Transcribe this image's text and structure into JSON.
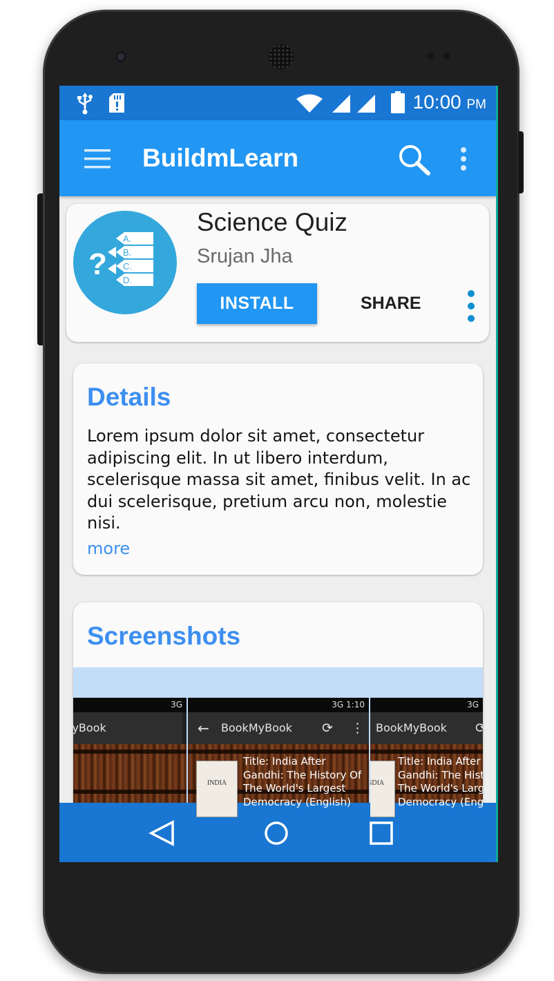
{
  "status_bar": {
    "time": "10:00",
    "ampm": "PM",
    "icons": [
      "usb-icon",
      "sd-card-icon",
      "wifi-icon",
      "signal-icon",
      "signal-icon",
      "battery-icon"
    ]
  },
  "app_bar": {
    "title": "BuildmLearn",
    "icons": [
      "menu-icon",
      "search-icon",
      "overflow-menu-icon"
    ]
  },
  "app_card": {
    "name": "Science Quiz",
    "author": "Srujan Jha",
    "install_label": "INSTALL",
    "share_label": "SHARE",
    "logo_labels": [
      "A.",
      "B.",
      "C.",
      "D."
    ]
  },
  "details": {
    "title": "Details",
    "body": "Lorem ipsum dolor sit amet, consectetur adipiscing elit. In ut libero interdum, scelerisque massa sit amet, finibus velit. In ac dui scelerisque, pretium arcu non, molestie nisi.",
    "more_label": "more"
  },
  "screenshots": {
    "title": "Screenshots",
    "items": [
      {
        "status": "3G",
        "toolbar_title": "lyBook",
        "book_text": []
      },
      {
        "status": "3G 1:10",
        "toolbar_title": "BookMyBook",
        "book_text": [
          "Title: India After",
          "Gandhi: The History Of",
          "The World's Largest",
          "Democracy (English)"
        ]
      },
      {
        "status": "3G",
        "toolbar_title": "BookMyBook",
        "book_text": [
          "Title: India After",
          "Gandhi: The Histo",
          "The World's Large",
          "Democracy (Engli"
        ]
      }
    ],
    "cover_title": "INDIA"
  },
  "nav_bar": {
    "icons": [
      "back-icon",
      "home-icon",
      "recents-icon"
    ]
  },
  "colors": {
    "status_bar": "#1976d2",
    "app_bar": "#2196f3",
    "accent": "#3d8ff0",
    "logo": "#34a8dc",
    "nav_bar": "#1976d2"
  }
}
